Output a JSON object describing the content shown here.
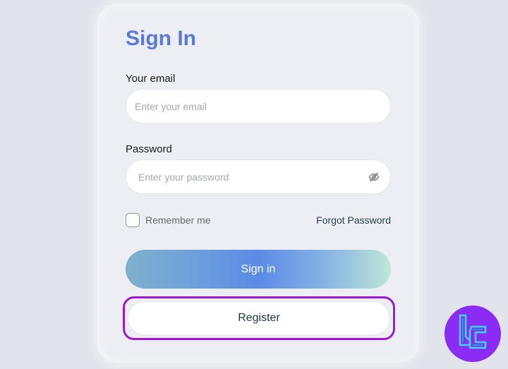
{
  "form": {
    "title": "Sign In",
    "email_label": "Your email",
    "email_placeholder": "Enter your email",
    "password_label": "Password",
    "password_placeholder": "Enter your password",
    "password_toggle_icon": "eye-off-icon",
    "remember_label": "Remember me",
    "remember_checked": false,
    "forgot_label": "Forgot Password",
    "signin_label": "Sign in",
    "register_label": "Register"
  },
  "colors": {
    "page_bg": "#e1e4ea",
    "card_bg": "#eceef3",
    "title": "#5b79d6",
    "highlight_border": "#9b1ad1",
    "logo_bg": "#8b2cf5",
    "logo_glyph": "#38d9f0"
  },
  "watermark": {
    "icon": "brand-logo-icon"
  }
}
